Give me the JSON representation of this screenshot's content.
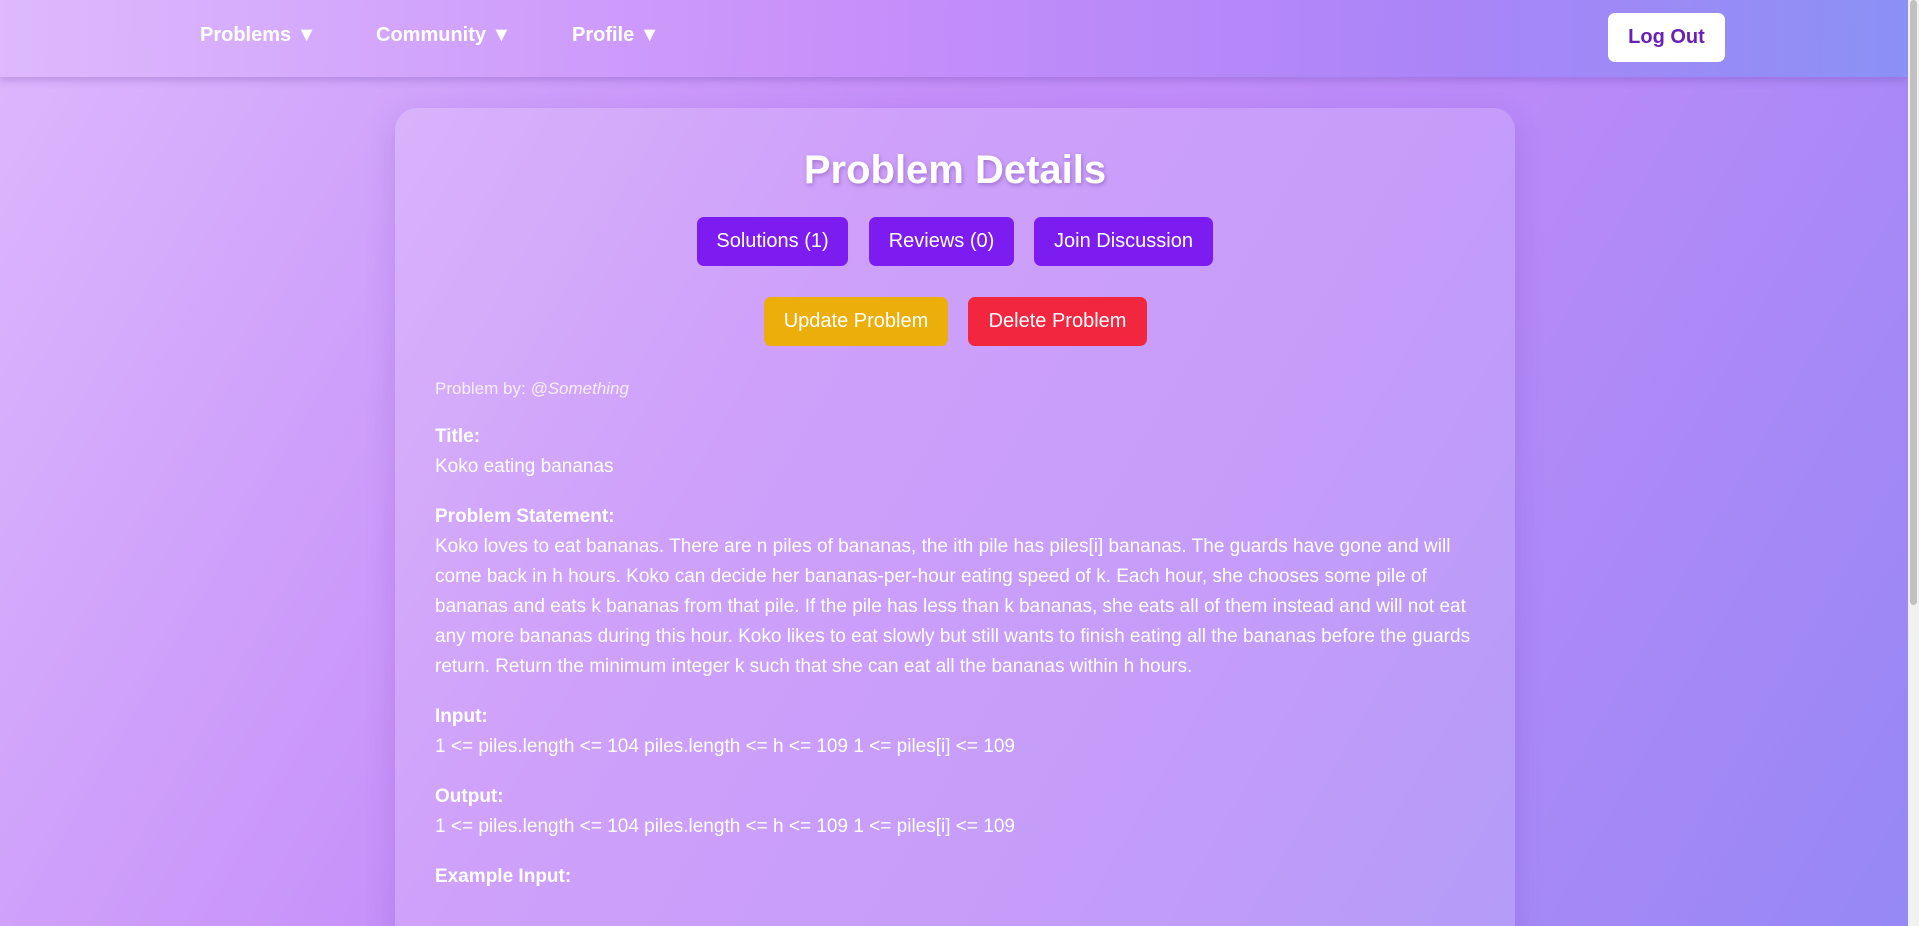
{
  "nav": {
    "items": [
      {
        "label": "Problems ▼"
      },
      {
        "label": "Community ▼"
      },
      {
        "label": "Profile ▼"
      }
    ],
    "logout_label": "Log Out"
  },
  "card": {
    "title": "Problem Details",
    "tabs": {
      "solutions": "Solutions (1)",
      "reviews": "Reviews (0)",
      "discussion": "Join Discussion"
    },
    "actions": {
      "update": "Update Problem",
      "delete": "Delete Problem"
    },
    "author_prefix": "Problem by:",
    "author_handle": "@Something",
    "fields": {
      "title_label": "Title:",
      "title_value": "Koko eating bananas",
      "statement_label": "Problem Statement:",
      "statement_value": "Koko loves to eat bananas. There are n piles of bananas, the ith pile has piles[i] bananas. The guards have gone and will come back in h hours. Koko can decide her bananas-per-hour eating speed of k. Each hour, she chooses some pile of bananas and eats k bananas from that pile. If the pile has less than k bananas, she eats all of them instead and will not eat any more bananas during this hour. Koko likes to eat slowly but still wants to finish eating all the bananas before the guards return. Return the minimum integer k such that she can eat all the bananas within h hours.",
      "input_label": "Input:",
      "input_value": "1 <= piles.length <= 104 piles.length <= h <= 109 1 <= piles[i] <= 109",
      "output_label": "Output:",
      "output_value": "1 <= piles.length <= 104 piles.length <= h <= 109 1 <= piles[i] <= 109",
      "example_input_label": "Example Input:"
    }
  },
  "colors": {
    "primary_button": "#7c1cf0",
    "update_button": "#ecae0a",
    "delete_button": "#f2263f",
    "logout_text": "#6a1fb5"
  }
}
